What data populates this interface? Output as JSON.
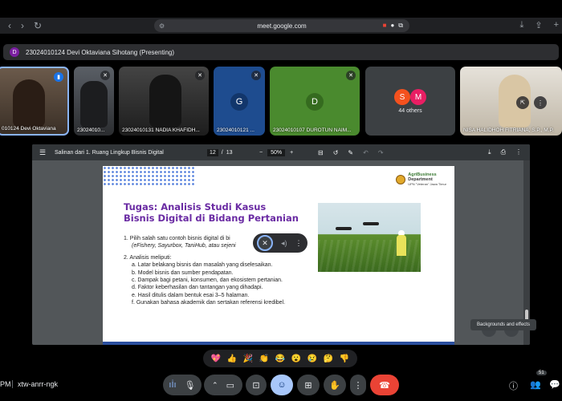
{
  "browser": {
    "url": "meet.google.com"
  },
  "presenting_bar": {
    "avatar_letter": "D",
    "label": "23024010124 Devi Oktaviana Sihotang (Presenting)"
  },
  "tiles": [
    {
      "name": "010124 Devi Oktaviana"
    },
    {
      "name": "23024010..."
    },
    {
      "name": "23024010131 NADIA KHAFIDH..."
    },
    {
      "name": "23024010121 ...",
      "letter": "G"
    },
    {
      "name": "23024010107 DUROTUN NAIM...",
      "letter": "D"
    },
    {
      "name": "44 others",
      "letters": [
        "S",
        "M"
      ]
    },
    {
      "name": "NISA HALIDHOH FITRIANA, S.P., M.P."
    }
  ],
  "pdf": {
    "title": "Salinan dari 1. Ruang Lingkup Bisnis Digital",
    "page_current": "12",
    "page_total": "13",
    "zoom": "50%"
  },
  "slide": {
    "logo_line1": "AgriBusiness",
    "logo_line2": "Department",
    "logo_line3": "UPN \"Veteran\" Jawa Timur",
    "title_line1": "Tugas: Analisis Studi Kasus",
    "title_line2": "Bisnis Digital di Bidang Pertanian",
    "item1": "1.  Pilih salah satu contoh bisnis digital di bi",
    "item1_examples": "(eFishery, Sayurbox, TaniHub, atau sejeni",
    "item2": "2. Analisis meliputi:",
    "subitems": [
      "a. Latar belakang bisnis dan masalah yang diselesaikan.",
      "b. Model bisnis dan sumber pendapatan.",
      "c. Dampak bagi petani, konsumen, dan ekosistem pertanian.",
      "d. Faktor keberhasilan dan tantangan yang dihadapi.",
      "e. Hasil ditulis dalam bentuk esai 3–5 halaman.",
      "f.  Gunakan bahasa akademik dan sertakan referensi kredibel."
    ]
  },
  "tooltip": "Backgrounds and effects",
  "reactions": [
    "💖",
    "👍",
    "🎉",
    "👏",
    "😂",
    "😮",
    "😢",
    "🤔",
    "👎"
  ],
  "bottom": {
    "time": "PM",
    "meeting_code": "xtw-anrr-ngk",
    "participants_badge": "51"
  },
  "colors": {
    "accent": "#a8c7fa",
    "end_call": "#ea4335",
    "title_purple": "#6a2ba3"
  }
}
